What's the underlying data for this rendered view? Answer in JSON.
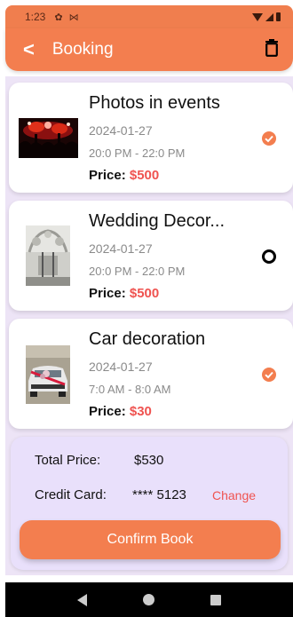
{
  "status_bar": {
    "time": "1:23"
  },
  "header": {
    "title": "Booking",
    "back_glyph": "<"
  },
  "bookings": [
    {
      "name": "Photos in events",
      "date": "2024-01-27",
      "time": "20:0 PM - 22:0 PM",
      "price_label": "Price:",
      "price": "$500",
      "selected": true,
      "image": "concert-crowd-image"
    },
    {
      "name": "Wedding Decor...",
      "date": "2024-01-27",
      "time": "20:0 PM - 22:0 PM",
      "price_label": "Price:",
      "price": "$500",
      "selected": false,
      "image": "wedding-decor-image"
    },
    {
      "name": "Car decoration",
      "date": "2024-01-27",
      "time": "7:0 AM - 8:0 AM",
      "price_label": "Price:",
      "price": "$30",
      "selected": true,
      "image": "car-decoration-image"
    }
  ],
  "summary": {
    "total_label": "Total Price:",
    "total_value": "$530",
    "card_label": "Credit Card:",
    "card_value": "**** 5123",
    "change_label": "Change",
    "confirm_label": "Confirm Book"
  },
  "colors": {
    "accent": "#f37e4f",
    "price": "#ef5350",
    "background": "#ede4f6"
  }
}
